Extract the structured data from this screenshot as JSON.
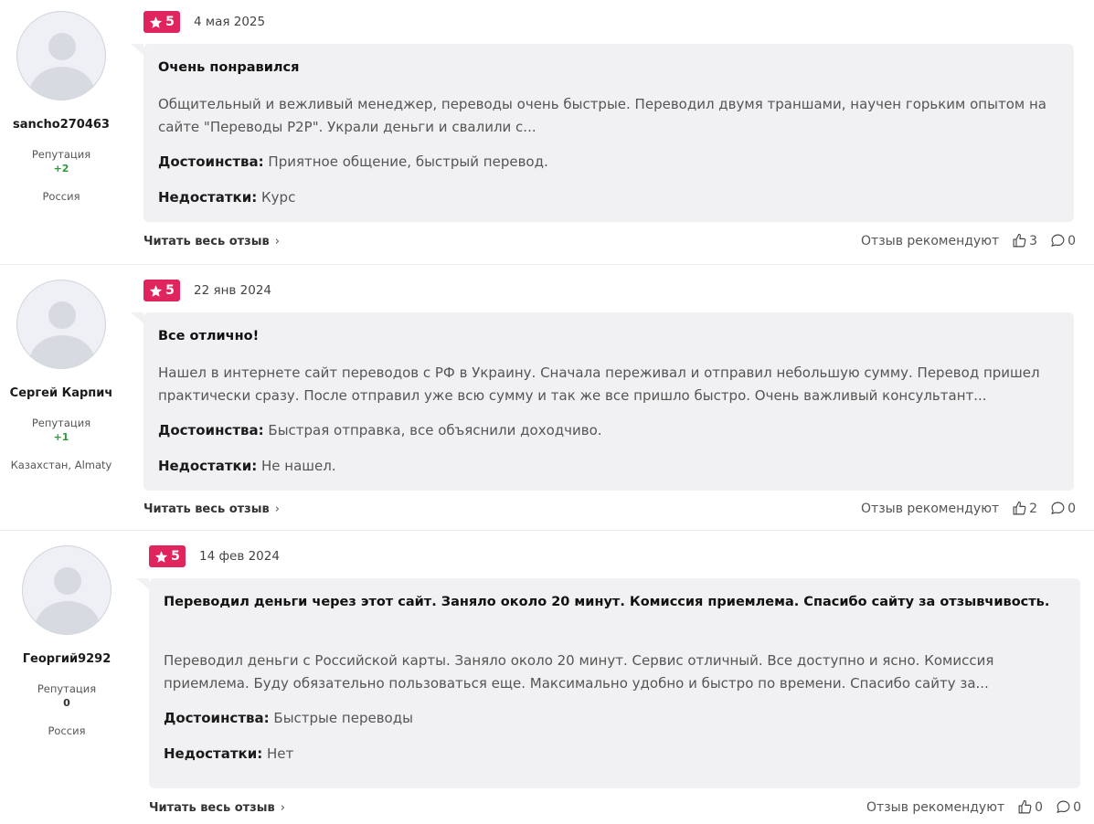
{
  "common": {
    "reputation_label": "Репутация",
    "read_more": "Читать весь отзыв",
    "recommend_label": "Отзыв рекомендуют",
    "pros_label": "Достоинства:",
    "cons_label": "Недостатки:"
  },
  "colors": {
    "badge": "#e0245e",
    "card_bg": "#f1f1f4",
    "reputation_positive": "#2e9b3a"
  },
  "reviews": [
    {
      "username": "sancho270463",
      "reputation": "+2",
      "location": "Россия",
      "rating": "5",
      "date": "4 мая 2025",
      "title": "Очень понравился",
      "text": "Общительный и вежливый менеджер, переводы очень быстрые. Переводил двумя траншами, научен горьким опытом на сайте \"Переводы P2P\". Украли деньги и свалили с...",
      "pros": "Приятное общение, быстрый перевод.",
      "cons": "Курс",
      "likes": "3",
      "comments": "0"
    },
    {
      "username": "Сергей Карпич",
      "reputation": "+1",
      "location": "Казахстан, Almaty",
      "rating": "5",
      "date": "22 янв 2024",
      "title": "Все отлично!",
      "text": "Нашел в интернете сайт переводов с РФ в Украину. Сначала переживал и отправил небольшую сумму. Перевод пришел практически сразу. После отправил уже всю сумму и так же все пришло быстро. Очень важливый консультант...",
      "pros": "Быстрая отправка, все объяснили доходчиво.",
      "cons": "Не нашел.",
      "likes": "2",
      "comments": "0"
    },
    {
      "username": "Георгий9292",
      "reputation": "0",
      "location": "Россия",
      "rating": "5",
      "date": "14 фев 2024",
      "title": "Переводил деньги через этот сайт. Заняло около 20 минут. Комиссия приемлема. Спасибо сайту за отзывчивость.",
      "text": "Переводил деньги с Российской карты. Заняло около 20 минут. Сервис отличный. Все доступно и ясно. Комиссия приемлема. Буду обязательно пользоваться еще. Максимально удобно и быстро по времени. Спасибо сайту за...",
      "pros": "Быстрые переводы",
      "cons": "Нет",
      "likes": "0",
      "comments": "0"
    }
  ],
  "icons": {
    "rating": "star-icon",
    "read_more": "chevron-right-icon",
    "like": "thumbs-up-icon",
    "comment": "comment-bubble-icon"
  }
}
